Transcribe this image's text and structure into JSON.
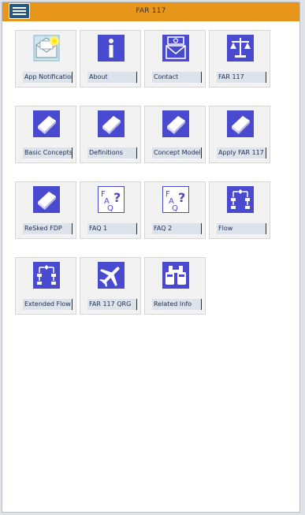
{
  "header": {
    "title": "FAR 117",
    "menu_icon": "hamburger-menu-icon"
  },
  "colors": {
    "header": "#e8951c",
    "icon_bg": "#4a4ad0",
    "label_text": "#1c2c55"
  },
  "tiles": [
    {
      "label": "App Notifications",
      "icon": "envelope-notification-icon"
    },
    {
      "label": "About",
      "icon": "info-icon"
    },
    {
      "label": "Contact",
      "icon": "mail-contact-icon"
    },
    {
      "label": "FAR 117",
      "icon": "scales-icon"
    },
    {
      "label": "Basic Concepts",
      "icon": "book-icon"
    },
    {
      "label": "Definitions",
      "icon": "book-icon"
    },
    {
      "label": "Concept Model",
      "icon": "book-icon"
    },
    {
      "label": "Apply FAR 117",
      "icon": "book-icon"
    },
    {
      "label": "ReSked FDP",
      "icon": "book-icon"
    },
    {
      "label": "FAQ 1",
      "icon": "faq-icon"
    },
    {
      "label": "FAQ 2",
      "icon": "faq-icon"
    },
    {
      "label": "Flow",
      "icon": "flowchart-icon"
    },
    {
      "label": "Extended Flow",
      "icon": "flowchart-icon"
    },
    {
      "label": "FAR 117 QRG",
      "icon": "airplane-icon"
    },
    {
      "label": "Related Info",
      "icon": "binoculars-icon"
    }
  ]
}
